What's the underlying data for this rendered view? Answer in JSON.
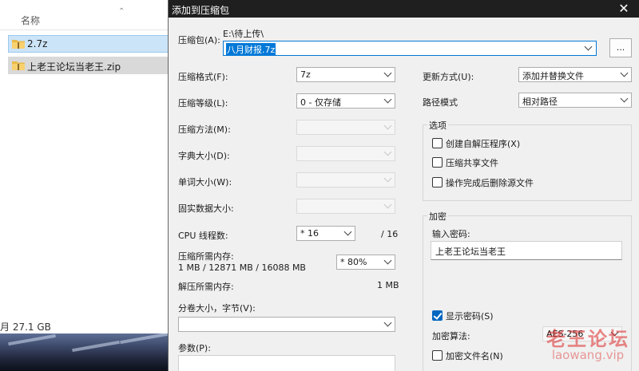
{
  "explorer": {
    "column_name": "名称",
    "files": [
      {
        "name": "2.7z"
      },
      {
        "name": "上老王论坛当老王.zip"
      }
    ],
    "status_text": "月 27.1 GB"
  },
  "dialog": {
    "title": "添加到压缩包",
    "archive": {
      "label": "压缩包(A):",
      "path": "E:\\待上传\\",
      "filename": "八月财报.7z",
      "browse_label": "..."
    },
    "left": {
      "format_label": "压缩格式(F):",
      "format_value": "7z",
      "level_label": "压缩等级(L):",
      "level_value": "0 - 仅存储",
      "method_label": "压缩方法(M):",
      "dict_label": "字典大小(D):",
      "word_label": "单词大小(W):",
      "solid_label": "固实数据大小:",
      "threads_label": "CPU 线程数:",
      "threads_value": "* 16",
      "threads_total": "/ 16",
      "mem_compress_label": "压缩所需内存:",
      "mem_compress_detail": "1 MB / 12871 MB / 16088 MB",
      "mem_percent": "* 80%",
      "mem_decompress_label": "解压所需内存:",
      "mem_decompress_value": "1 MB",
      "split_label": "分卷大小，字节(V):",
      "split_value": "",
      "params_label": "参数(P):"
    },
    "right": {
      "update_label": "更新方式(U):",
      "update_value": "添加并替换文件",
      "path_mode_label": "路径模式",
      "path_mode_value": "相对路径",
      "options_title": "选项",
      "opt_sfx": "创建自解压程序(X)",
      "opt_shared": "压缩共享文件",
      "opt_delete": "操作完成后删除源文件",
      "encryption_title": "加密",
      "password_label": "输入密码:",
      "password_value": "上老王论坛当老王",
      "show_password": "显示密码(S)",
      "enc_method_label": "加密算法:",
      "enc_method_value": "AES-256",
      "enc_filenames": "加密文件名(N)"
    }
  },
  "watermark": {
    "line1": "老王论坛",
    "line2": "laowang.vip"
  },
  "colors": {
    "accent": "#0078d7",
    "titlebar": "#1f1f1f",
    "selection": "#cce4f7"
  }
}
